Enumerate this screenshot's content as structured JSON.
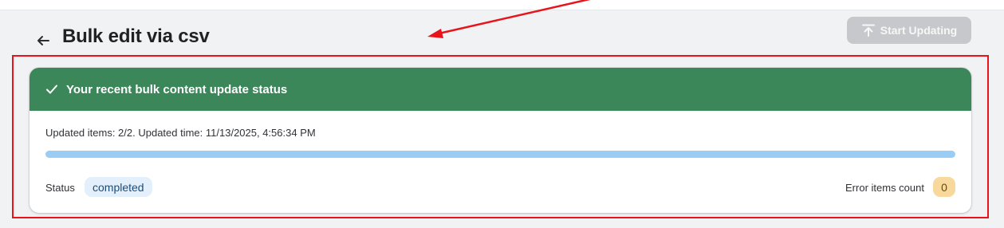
{
  "header": {
    "title": "Bulk edit via csv",
    "back_icon": "arrow-left-icon",
    "start_button_label": "Start Updating",
    "start_button_icon": "upload-icon",
    "start_button_disabled": true
  },
  "status_card": {
    "title": "Your recent bulk content update status",
    "title_icon": "checkmark-icon",
    "header_color": "#3b875a",
    "updated_line": "Updated items: 2/2. Updated time: 11/13/2025, 4:56:34 PM",
    "progress_percent": 100,
    "progress_color": "#99cdf5",
    "status_label": "Status",
    "status_value": "completed",
    "status_badge_color": "#e3f0fb",
    "error_label": "Error items count",
    "error_count": "0",
    "error_badge_color": "#f7d89d"
  },
  "annotation": {
    "color": "#e8141b"
  }
}
